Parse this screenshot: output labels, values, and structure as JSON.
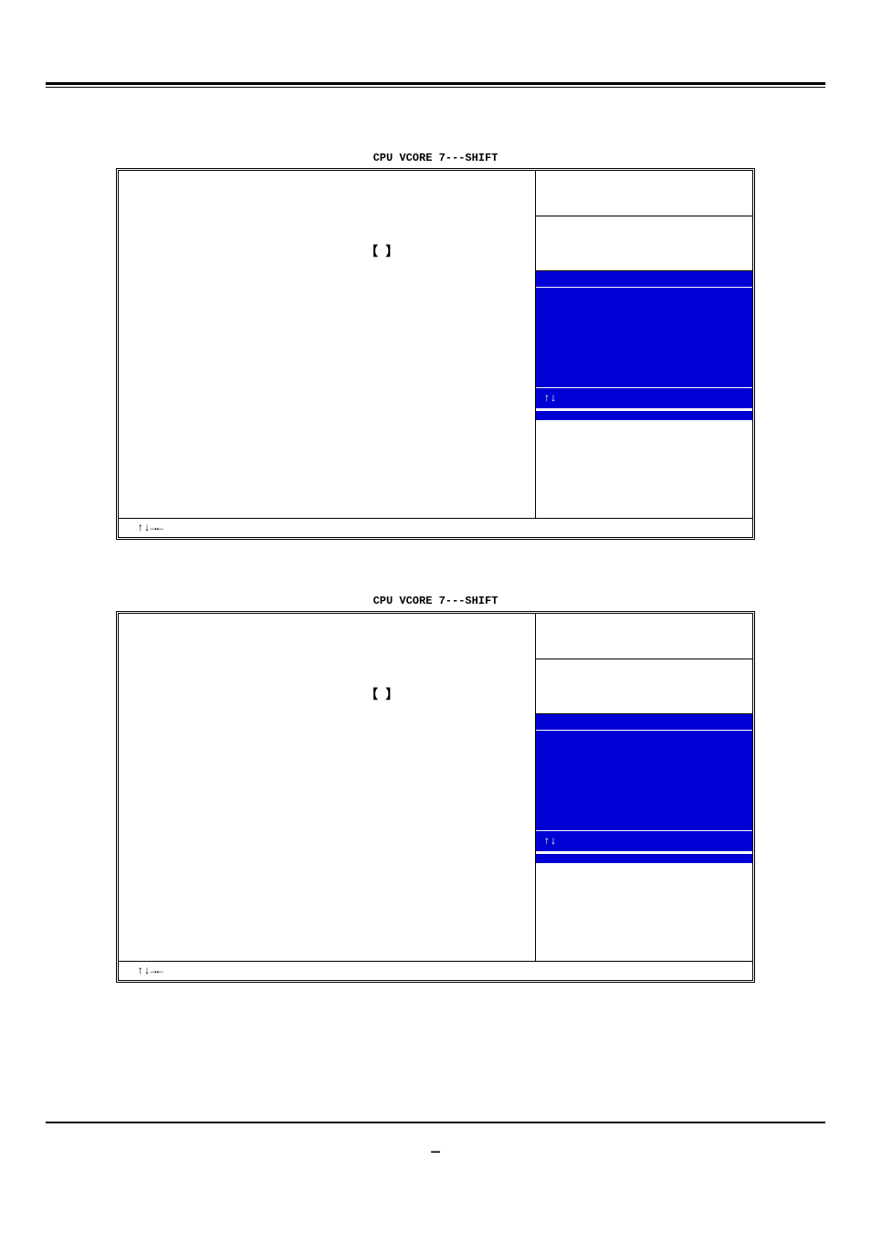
{
  "section1": {
    "title": "CPU  VCORE  7---SHIFT",
    "cursor": "【   】",
    "right": {
      "header": "",
      "sel_line": "↑↓"
    },
    "footer_arrows": "↑↓→←"
  },
  "section2": {
    "title": "CPU  VCORE  7---SHIFT",
    "cursor": "【   】",
    "right": {
      "header": "",
      "sel_line": "↑↓"
    },
    "footer_arrows": "↑↓→←"
  },
  "page_num": "—"
}
